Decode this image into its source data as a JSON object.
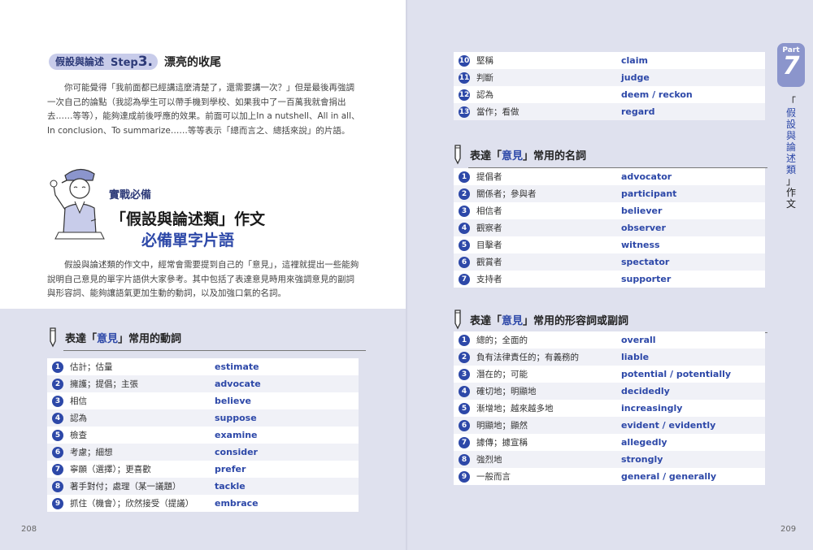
{
  "left": {
    "step_tag": {
      "label": "假設與論述",
      "step": "Step",
      "step_num": "3.",
      "title": "漂亮的收尾"
    },
    "para1": "你可能覺得「我前面都已經講這麼清楚了，還需要講一次？」但是最後再強調一次自己的論點（我認為學生可以帶手機到學校、如果我中了一百萬我就會捐出去……等等），能夠達成前後呼應的效果。前面可以加上In a nutshell、All in all、In conclusion、To summarize……等等表示「總而言之、總括來說」的片語。",
    "badge": "實戰必備",
    "headline1": "「假設與論述類」作文",
    "headline2": "必備單字片語",
    "para2": "假設與論述類的作文中，經常會需要提到自己的「意見」，這裡就提出一些能夠說明自己意見的單字片語供大家參考。其中包括了表達意見時用來強調意見的副詞與形容詞、能夠讓語氣更加生動的動詞，以及加強口氣的名詞。",
    "verbs_section": {
      "pre": "表達「",
      "hl": "意見",
      "post": "」常用的動詞"
    },
    "verbs": [
      {
        "n": "1",
        "zh": "估計；估量",
        "en": "estimate"
      },
      {
        "n": "2",
        "zh": "擁護；提倡；主張",
        "en": "advocate"
      },
      {
        "n": "3",
        "zh": "相信",
        "en": "believe"
      },
      {
        "n": "4",
        "zh": "認為",
        "en": "suppose"
      },
      {
        "n": "5",
        "zh": "檢查",
        "en": "examine"
      },
      {
        "n": "6",
        "zh": "考慮；細想",
        "en": "consider"
      },
      {
        "n": "7",
        "zh": "寧願（選擇）；更喜歡",
        "en": "prefer"
      },
      {
        "n": "8",
        "zh": "著手對付；處理（某一議題）",
        "en": "tackle"
      },
      {
        "n": "9",
        "zh": "抓住（機會）；欣然接受（提議）",
        "en": "embrace"
      }
    ],
    "page_number": "208"
  },
  "right": {
    "verbs_cont": [
      {
        "n": "10",
        "zh": "堅稱",
        "en": "claim"
      },
      {
        "n": "11",
        "zh": "判斷",
        "en": "judge"
      },
      {
        "n": "12",
        "zh": "認為",
        "en": "deem / reckon"
      },
      {
        "n": "13",
        "zh": "當作；看做",
        "en": "regard"
      }
    ],
    "nouns_section": {
      "pre": "表達「",
      "hl": "意見",
      "post": "」常用的名詞"
    },
    "nouns": [
      {
        "n": "1",
        "zh": "提倡者",
        "en": "advocator"
      },
      {
        "n": "2",
        "zh": "關係者；參與者",
        "en": "participant"
      },
      {
        "n": "3",
        "zh": "相信者",
        "en": "believer"
      },
      {
        "n": "4",
        "zh": "觀察者",
        "en": "observer"
      },
      {
        "n": "5",
        "zh": "目擊者",
        "en": "witness"
      },
      {
        "n": "6",
        "zh": "觀賞者",
        "en": "spectator"
      },
      {
        "n": "7",
        "zh": "支持者",
        "en": "supporter"
      }
    ],
    "adj_section": {
      "pre": "表達「",
      "hl": "意見",
      "post": "」常用的形容詞或副詞"
    },
    "adjs": [
      {
        "n": "1",
        "zh": "總的；全面的",
        "en": "overall"
      },
      {
        "n": "2",
        "zh": "負有法律責任的；有義務的",
        "en": "liable"
      },
      {
        "n": "3",
        "zh": "潛在的；可能",
        "en": "potential / potentially"
      },
      {
        "n": "4",
        "zh": "確切地；明顯地",
        "en": "decidedly"
      },
      {
        "n": "5",
        "zh": "漸增地；越來越多地",
        "en": "increasingly"
      },
      {
        "n": "6",
        "zh": "明顯地；顯然",
        "en": "evident / evidently"
      },
      {
        "n": "7",
        "zh": "據傳；據宣稱",
        "en": "allegedly"
      },
      {
        "n": "8",
        "zh": "強烈地",
        "en": "strongly"
      },
      {
        "n": "9",
        "zh": "一般而言",
        "en": "general / generally"
      }
    ],
    "part": {
      "label": "Part",
      "number": "7"
    },
    "side_title": [
      "「",
      "假",
      "設",
      "與",
      "論",
      "述",
      "類",
      "」",
      "作",
      "文"
    ],
    "page_number": "209"
  },
  "colors": {
    "accent": "#2d48a8",
    "tab": "#8b95cc",
    "background": "#dfe1ee"
  }
}
